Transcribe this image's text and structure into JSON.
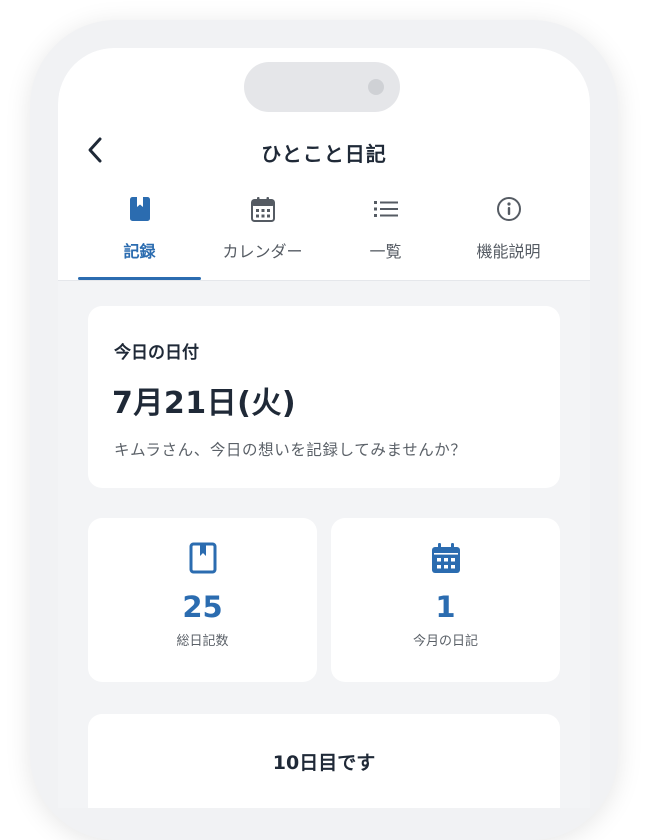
{
  "header": {
    "title": "ひとこと日記",
    "back_icon": "chevron-left-icon"
  },
  "tabs": [
    {
      "label": "記録",
      "icon": "bookmark-book-icon",
      "active": true
    },
    {
      "label": "カレンダー",
      "icon": "calendar-icon",
      "active": false
    },
    {
      "label": "一覧",
      "icon": "list-icon",
      "active": false
    },
    {
      "label": "機能説明",
      "icon": "info-icon",
      "active": false
    }
  ],
  "today": {
    "label": "今日の日付",
    "date": "7月21日(火)",
    "message": "キムラさん、今日の想いを記録してみませんか？"
  },
  "stats": {
    "total": {
      "value": "25",
      "label": "総日記数"
    },
    "month": {
      "value": "1",
      "label": "今月の日記"
    }
  },
  "streak": {
    "title": "10日目です"
  },
  "colors": {
    "accent": "#2b6cb0",
    "background": "#f3f4f6",
    "card": "#ffffff",
    "text": "#1f2937",
    "muted": "#5b6168"
  }
}
